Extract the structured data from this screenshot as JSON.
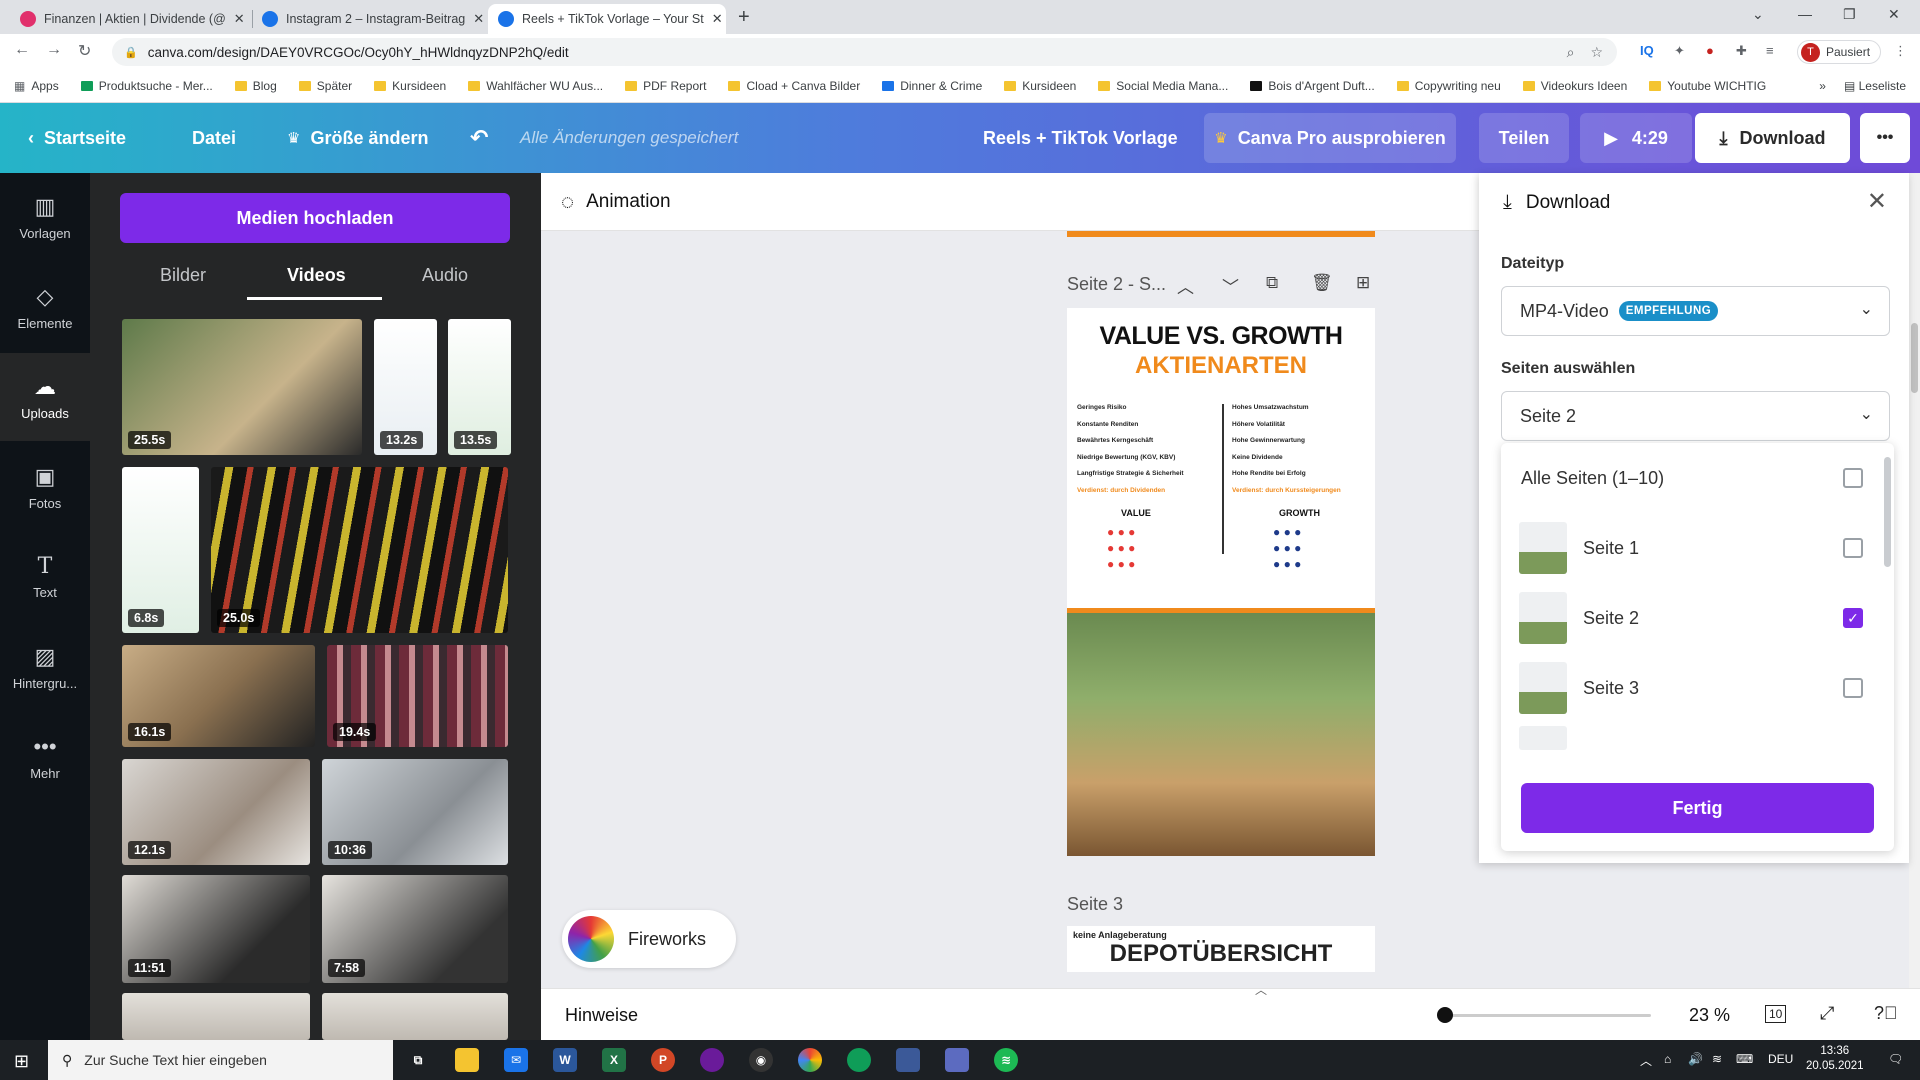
{
  "browser": {
    "tabs": [
      {
        "title": "Finanzen | Aktien | Dividende (@",
        "active": false
      },
      {
        "title": "Instagram 2 – Instagram-Beitrag",
        "active": false
      },
      {
        "title": "Reels + TikTok Vorlage – Your St",
        "active": true
      }
    ],
    "url": "canva.com/design/DAEY0VRCGOc/Ocy0hY_hHWldnqyzDNP2hQ/edit",
    "profile_initial": "T",
    "profile_status": "Pausiert",
    "bookmarks": [
      "Apps",
      "Produktsuche - Mer...",
      "Blog",
      "Später",
      "Kursideen",
      "Wahlfächer WU Aus...",
      "PDF Report",
      "Cload + Canva Bilder",
      "Dinner & Crime",
      "Kursideen",
      "Social Media Mana...",
      "Bois d'Argent Duft...",
      "Copywriting neu",
      "Videokurs Ideen",
      "Youtube WICHTIG"
    ],
    "reading_list": "Leseliste"
  },
  "header": {
    "home": "Startseite",
    "file": "Datei",
    "resize": "Größe ändern",
    "saved_status": "Alle Änderungen gespeichert",
    "design_title": "Reels + TikTok Vorlage",
    "pro_trial": "Canva Pro ausprobieren",
    "share": "Teilen",
    "play_duration": "4:29",
    "download": "Download",
    "more": "•••"
  },
  "rail": [
    {
      "label": "Vorlagen",
      "icon": "template-icon"
    },
    {
      "label": "Elemente",
      "icon": "elements-icon"
    },
    {
      "label": "Uploads",
      "icon": "upload-cloud-icon"
    },
    {
      "label": "Fotos",
      "icon": "photo-icon"
    },
    {
      "label": "Text",
      "icon": "text-icon"
    },
    {
      "label": "Hintergru...",
      "icon": "background-icon"
    },
    {
      "label": "Mehr",
      "icon": "more-dots-icon"
    }
  ],
  "uploads": {
    "button": "Medien hochladen",
    "tabs": [
      "Bilder",
      "Videos",
      "Audio"
    ],
    "videos": [
      "25.5s",
      "13.2s",
      "13.5s",
      "6.8s",
      "25.0s",
      "16.1s",
      "19.4s",
      "12.1s",
      "10:36",
      "11:51",
      "7:58"
    ]
  },
  "editor": {
    "animation": "Animation",
    "page2_label": "Seite 2 - S...",
    "page3_label": "Seite 3",
    "effect": "Fireworks",
    "hints": "Hinweise",
    "zoom": "23 %",
    "zoom_fraction": 0.02,
    "page_count_icon": "10"
  },
  "poster": {
    "title": "VALUE VS. GROWTH",
    "subtitle": "AKTIENARTEN",
    "value_points": [
      "Geringes Risiko",
      "Konstante Renditen",
      "Bewährtes Kerngeschäft",
      "Niedrige Bewertung (KGV, KBV)",
      "Langfristige Strategie & Sicherheit",
      "Verdienst: durch Dividenden"
    ],
    "growth_points": [
      "Hohes Umsatzwachstum",
      "Höhere Volatilität",
      "Hohe Gewinnerwartung",
      "Keine Dividende",
      "Hohe Rendite bei Erfolg",
      "Verdienst: durch Kurssteigerungen"
    ],
    "value_col": "VALUE",
    "growth_col": "GROWTH",
    "page3_note": "keine Anlageberatung",
    "page3_title": "DEPOTÜBERSICHT"
  },
  "download_panel": {
    "title": "Download",
    "filetype_label": "Dateityp",
    "filetype_value": "MP4-Video",
    "recommend_badge": "EMPFEHLUNG",
    "pages_label": "Seiten auswählen",
    "pages_value": "Seite 2",
    "options": [
      {
        "label": "Alle Seiten (1–10)",
        "checked": false
      },
      {
        "label": "Seite 1",
        "checked": false
      },
      {
        "label": "Seite 2",
        "checked": true
      },
      {
        "label": "Seite 3",
        "checked": false
      }
    ],
    "done": "Fertig"
  },
  "taskbar": {
    "search_placeholder": "Zur Suche Text hier eingeben",
    "language": "DEU",
    "time": "13:36",
    "date": "20.05.2021"
  }
}
